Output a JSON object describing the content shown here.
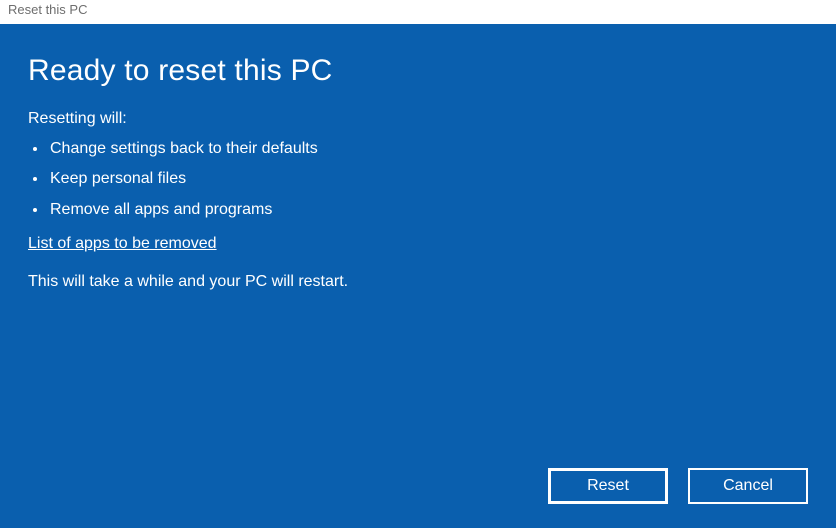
{
  "window": {
    "title": "Reset this PC"
  },
  "main": {
    "heading": "Ready to reset this PC",
    "intro": "Resetting will:",
    "bullets": [
      "Change settings back to their defaults",
      "Keep personal files",
      "Remove all apps and programs"
    ],
    "link_label": "List of apps to be removed",
    "note": "This will take a while and your PC will restart."
  },
  "actions": {
    "primary": "Reset",
    "secondary": "Cancel"
  }
}
